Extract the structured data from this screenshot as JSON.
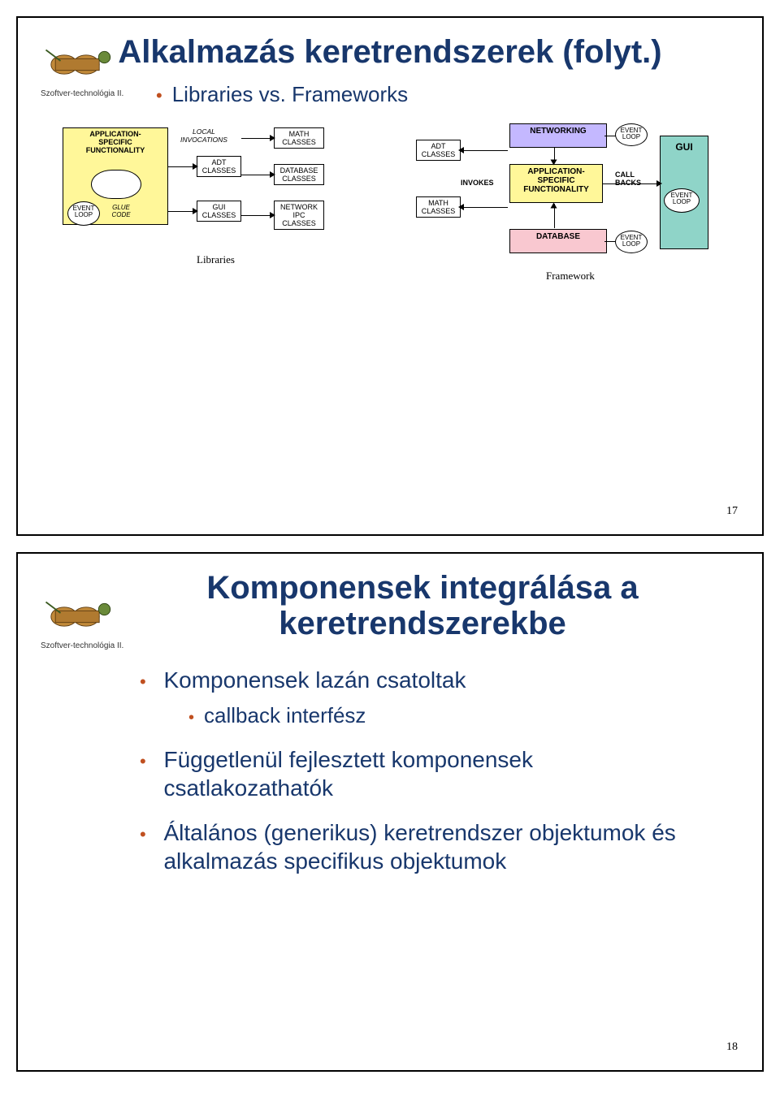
{
  "slide1": {
    "corner_label": "Szoftver-technológia II.",
    "title": "Alkalmazás keretrendszerek (folyt.)",
    "bullet": "Libraries vs. Frameworks",
    "page_num": "17",
    "lib": {
      "app_specific": "APPLICATION-\nSPECIFIC\nFUNCTIONALITY",
      "event_loop": "EVENT\nLOOP",
      "glue_code": "GLUE\nCODE",
      "local_inv": "LOCAL\nINVOCATIONS",
      "adt": "ADT\nCLASSES",
      "gui": "GUI\nCLASSES",
      "math": "MATH\nCLASSES",
      "database": "DATABASE\nCLASSES",
      "network": "NETWORK\nIPC\nCLASSES",
      "caption": "Libraries"
    },
    "fw": {
      "adt": "ADT\nCLASSES",
      "math": "MATH\nCLASSES",
      "invokes": "INVOKES",
      "networking": "NETWORKING",
      "app_specific": "APPLICATION-\nSPECIFIC\nFUNCTIONALITY",
      "database": "DATABASE",
      "callbacks": "CALL\nBACKS",
      "event_loop": "EVENT\nLOOP",
      "gui": "GUI",
      "caption": "Framework"
    }
  },
  "slide2": {
    "corner_label": "Szoftver-technológia II.",
    "title": "Komponensek integrálása a keretrendszerekbe",
    "bullets": {
      "b1": "Komponensek lazán csatoltak",
      "b1a": "callback interfész",
      "b2": "Függetlenül fejlesztett komponensek csatlakozathatók",
      "b3": "Általános (generikus) keretrendszer objektumok és alkalmazás specifikus objektumok"
    },
    "page_num": "18"
  }
}
